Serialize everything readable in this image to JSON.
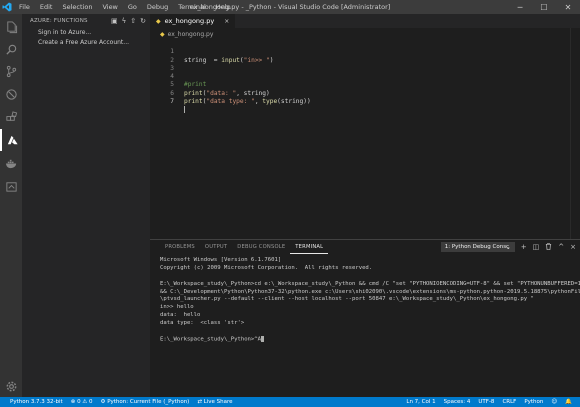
{
  "window": {
    "title": "ex_hongong.py - _Python - Visual Studio Code [Administrator]",
    "menu": [
      "File",
      "Edit",
      "Selection",
      "View",
      "Go",
      "Debug",
      "Terminal",
      "Help"
    ],
    "controls": {
      "minimize": "─",
      "maximize": "☐",
      "close": "✕"
    }
  },
  "sidebar": {
    "header": "AZURE: FUNCTIONS",
    "items": [
      "Sign in to Azure...",
      "Create a Free Azure Account..."
    ]
  },
  "editor": {
    "tab_label": "ex_hongong.py",
    "tab_close": "×",
    "breadcrumb": "ex_hongong.py",
    "icon_py": "◆",
    "line_numbers": [
      "1",
      "2",
      "3",
      "4",
      "5",
      "6",
      "7"
    ],
    "lines": {
      "l1_a": "string  = ",
      "l1_fn": "input",
      "l1_b": "(",
      "l1_str": "\"in>> \"",
      "l1_c": ")",
      "l4": "#print",
      "l5_fn": "print",
      "l5_a": "(",
      "l5_str": "\"data: \"",
      "l5_b": ", string)",
      "l6_fn": "print",
      "l6_a": "(",
      "l6_str": "\"data type: \"",
      "l6_b": ", ",
      "l6_fn2": "type",
      "l6_c": "(string))"
    }
  },
  "panel": {
    "tabs": [
      "PROBLEMS",
      "OUTPUT",
      "DEBUG CONSOLE",
      "TERMINAL"
    ],
    "active_tab": "TERMINAL",
    "terminal_select": "1: Python Debug Consc",
    "actions": {
      "add": "+",
      "split": "◫",
      "trash": "🗑",
      "maximize": "^",
      "close": "×"
    },
    "terminal_lines": [
      "Microsoft Windows [Version 6.1.7601]",
      "Copyright (c) 2009 Microsoft Corporation.  All rights reserved.",
      "",
      "E:\\_Workspace_study\\_Python>cd e:\\_Workspace_study\\_Python && cmd /C \"set \"PYTHONIOENCODING=UTF-8\" && set \"PYTHONUNBUFFERED=1\"",
      "&& C:\\_Development\\Python\\Python37-32\\python.exe c:\\Users\\shi02090\\.vscode\\extensions\\ms-python.python-2019.5.18875\\pythonFiles",
      "\\ptvsd_launcher.py --default --client --host localhost --port 50847 e:\\_Workspace_study\\_Python\\ex_hongong.py \"",
      "in>> hello",
      "data:  hello",
      "data type:  <class 'str'>",
      "",
      "E:\\_Workspace_study\\_Python>^A"
    ]
  },
  "statusbar": {
    "left": [
      "Python 3.7.3 32-bit",
      "⊗ 0  ⚠ 0",
      "⚙ Python: Current File (_Python)",
      "⇄ Live Share"
    ],
    "right": [
      "Ln 7, Col 1",
      "Spaces: 4",
      "UTF-8",
      "CRLF",
      "Python",
      "☺",
      "🔔"
    ]
  }
}
